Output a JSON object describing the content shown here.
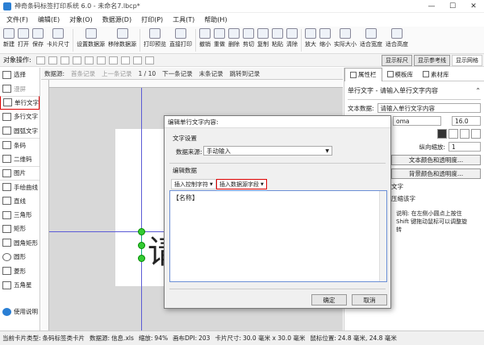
{
  "window": {
    "title": "神奇条码标签打印系统 6.0 - 未命名7.lbcp*",
    "controls": [
      "—",
      "☐",
      "✕"
    ]
  },
  "menu": [
    "文件(F)",
    "编辑(E)",
    "对象(O)",
    "数据源(D)",
    "打印(P)",
    "工具(T)",
    "帮助(H)"
  ],
  "toolbar": [
    "新建",
    "打开",
    "保存",
    "卡片尺寸",
    "设置数据源",
    "移除数据源",
    "打印预览",
    "直接打印",
    "撤销",
    "重做",
    "删除",
    "剪切",
    "复制",
    "粘贴",
    "清除",
    "放大",
    "缩小",
    "实际大小",
    "适合宽度",
    "适合高度"
  ],
  "objbar": {
    "label": "对象操作:",
    "show_buttons": [
      "显示标尺",
      "显示参考线",
      "显示网格"
    ]
  },
  "tools": [
    "选择",
    "漫屏",
    "单行文字",
    "多行文字",
    "圆弧文字",
    "条码",
    "二维码",
    "图片",
    "手绘曲线",
    "直线",
    "三角形",
    "矩形",
    "圆角矩形",
    "圆形",
    "菱形",
    "五角星",
    "使用说明"
  ],
  "records": {
    "label": "数据源:",
    "first": "首条记录",
    "prev": "上一条记录",
    "page": "1 / 10",
    "next": "下一条记录",
    "last": "末条记录",
    "jump": "跳转到记录"
  },
  "canvas": {
    "glyph": "请"
  },
  "right_panel": {
    "tabs": [
      "属性栏",
      "模板库",
      "素材库"
    ],
    "header": "单行文字 - 请输入单行文字内容",
    "text_data_label": "文本数据:",
    "text_data_value": "请输入单行文字内容",
    "font_name": "oma",
    "font_size": "16.0",
    "spacing_label": "纵向缩放:",
    "spacing_value": "1",
    "color_btn": "文本颜色和透明度...",
    "bg_btn": "背景颜色和透明度...",
    "vert_label": "文字",
    "compress_label": "压缩该字",
    "note": "说明: 在左侧小圆点上按住 Shift 键拖动鼠标可以调整旋转"
  },
  "dialog": {
    "title": "编辑单行文字内容:",
    "section1": "文字设置",
    "source_label": "数据来源:",
    "source_value": "手动输入",
    "section2": "编辑数据",
    "insert_ctrl": "插入控制字符",
    "insert_field": "插入数据源字段",
    "content": "【名称】",
    "ok": "确定",
    "cancel": "取消"
  },
  "status": {
    "card_type_label": "当前卡片类型:",
    "card_type": "条码标签类卡片",
    "ds_label": "数据源:",
    "ds": "信息.xls",
    "zoom_label": "缩放:",
    "zoom": "94%",
    "dpi_label": "画布DPI:",
    "dpi": "203",
    "size_label": "卡片尺寸:",
    "size": "30.0 毫米 x 30.0 毫米",
    "mouse_label": "鼠标位置:",
    "mouse": "24.8 毫米, 24.8 毫米"
  },
  "colors": {
    "accent": "#2a7fd4",
    "highlight": "#d00000",
    "guide": "#5b5bd6",
    "handle": "#33cc33"
  }
}
